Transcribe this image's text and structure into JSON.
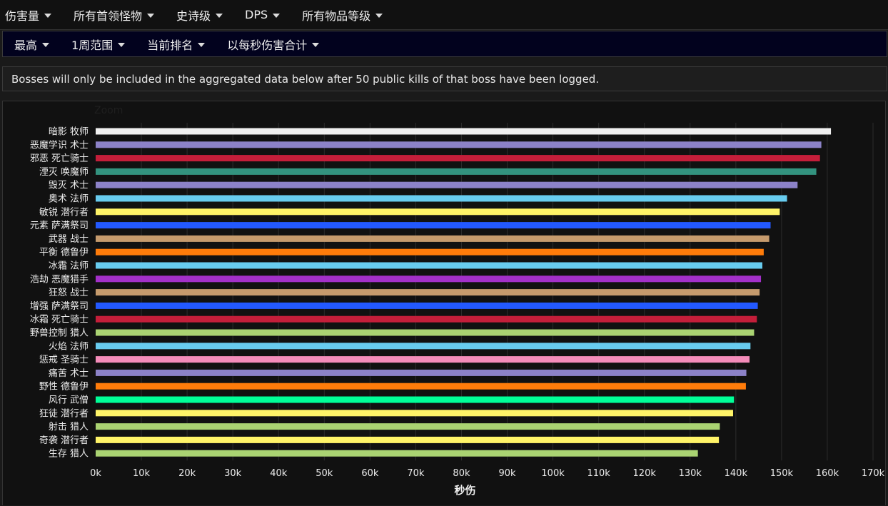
{
  "menubar": {
    "items": [
      {
        "label": "伤害量"
      },
      {
        "label": "所有首领怪物"
      },
      {
        "label": "史诗级"
      },
      {
        "label": "DPS"
      },
      {
        "label": "所有物品等级"
      }
    ]
  },
  "subbar": {
    "items": [
      {
        "label": "最高"
      },
      {
        "label": "1周范围"
      },
      {
        "label": "当前排名"
      },
      {
        "label": "以每秒伤害合计"
      }
    ]
  },
  "notice": {
    "text": "Bosses will only be included in the aggregated data below after 50 public kills of that boss have been logged."
  },
  "chart": {
    "zoom_label": "Zoom"
  },
  "chart_data": {
    "type": "bar",
    "orientation": "horizontal",
    "xlabel": "秒伤",
    "xlim": [
      0,
      170000
    ],
    "xticks": [
      0,
      10000,
      20000,
      30000,
      40000,
      50000,
      60000,
      70000,
      80000,
      90000,
      100000,
      110000,
      120000,
      130000,
      140000,
      150000,
      160000,
      170000
    ],
    "xtick_labels": [
      "0k",
      "10k",
      "20k",
      "30k",
      "40k",
      "50k",
      "60k",
      "70k",
      "80k",
      "90k",
      "100k",
      "110k",
      "120k",
      "130k",
      "140k",
      "150k",
      "160k",
      "170k"
    ],
    "grid": true,
    "categories": [
      "暗影 牧师",
      "恶魔学识 术士",
      "邪恶 死亡骑士",
      "湮灭 唤魔师",
      "毁灭 术士",
      "奥术 法师",
      "敏锐 潜行者",
      "元素 萨满祭司",
      "武器 战士",
      "平衡 德鲁伊",
      "冰霜 法师",
      "浩劫 恶魔猎手",
      "狂怒 战士",
      "增强 萨满祭司",
      "冰霜 死亡骑士",
      "野兽控制 猎人",
      "火焰 法师",
      "惩戒 圣骑士",
      "痛苦 术士",
      "野性 德鲁伊",
      "风行 武僧",
      "狂徒 潜行者",
      "射击 猎人",
      "奇袭 潜行者",
      "生存 猎人"
    ],
    "values": [
      160800,
      158700,
      158400,
      157600,
      153500,
      151200,
      149600,
      147600,
      147300,
      146100,
      145800,
      145500,
      145200,
      144800,
      144600,
      144000,
      143200,
      143000,
      142300,
      142200,
      139600,
      139400,
      136500,
      136300,
      131700
    ],
    "colors": [
      "#f0f0f0",
      "#8c82c8",
      "#c41e3a",
      "#33937f",
      "#8c82c8",
      "#68ccef",
      "#fff468",
      "#2359ff",
      "#c69b6d",
      "#ff7c0a",
      "#68ccef",
      "#a330c9",
      "#c69b6d",
      "#2359ff",
      "#c41e3a",
      "#aad372",
      "#68ccef",
      "#f48cba",
      "#8c82c8",
      "#ff7c0a",
      "#00ff98",
      "#fff468",
      "#aad372",
      "#fff468",
      "#aad372"
    ]
  }
}
